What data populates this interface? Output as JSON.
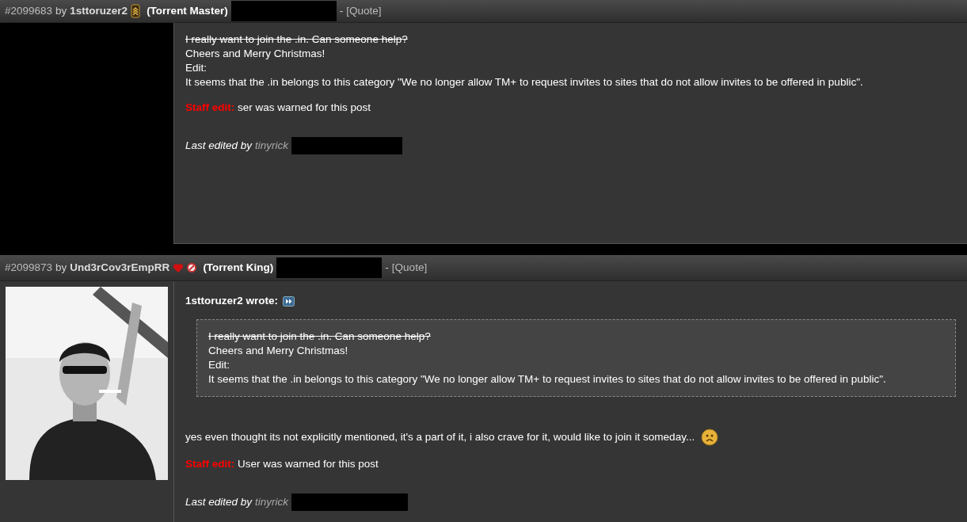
{
  "posts": [
    {
      "number": "#2099683",
      "by": "by",
      "author": "1sttoruzer2",
      "badges": [
        {
          "kind": "rank"
        }
      ],
      "user_class": "(Torrent Master)",
      "separator": "-",
      "quote_link": "[Quote]",
      "lines": [
        {
          "text": "I really want to join the .in. Can someone help?",
          "struck": true
        },
        {
          "text": "Cheers and Merry Christmas!",
          "struck": false
        },
        {
          "text": "Edit:",
          "struck": false
        },
        {
          "text": "It seems that the .in belongs to this category \"We no longer allow TM+ to request invites to sites that do not allow invites to be offered in public\".",
          "struck": false
        }
      ],
      "staff_edit": {
        "label": "Staff edit:",
        "text": "ser was warned for this post"
      },
      "last_edited": {
        "label": "Last edited by",
        "editor": "tinyrick"
      }
    },
    {
      "number": "#2099873",
      "by": "by",
      "author": "Und3rCov3rEmpRR",
      "badges": [
        {
          "kind": "heart"
        },
        {
          "kind": "warned"
        }
      ],
      "user_class": "(Torrent King)",
      "separator": "-",
      "quote_link": "[Quote]",
      "avatar": {
        "kind": "picture"
      },
      "quote": {
        "heading": "1sttoruzer2 wrote:",
        "lines": [
          {
            "text": "I really want to join the .in. Can someone help?",
            "struck": true
          },
          {
            "text": "Cheers and Merry Christmas!",
            "struck": false
          },
          {
            "text": "Edit:",
            "struck": false
          },
          {
            "text": "It seems that the .in belongs to this category \"We no longer allow TM+ to request invites to sites that do not allow invites to be offered in public\".",
            "struck": false
          }
        ]
      },
      "lines": [
        {
          "text": "yes even thought its not explicitly mentioned, it's a part of it, i also crave for it, would like to join it someday...",
          "struck": false,
          "smiley": true
        }
      ],
      "staff_edit": {
        "label": "Staff edit:",
        "text": "User was warned for this post"
      },
      "last_edited": {
        "label": "Last edited by",
        "editor": "tinyrick"
      }
    }
  ]
}
